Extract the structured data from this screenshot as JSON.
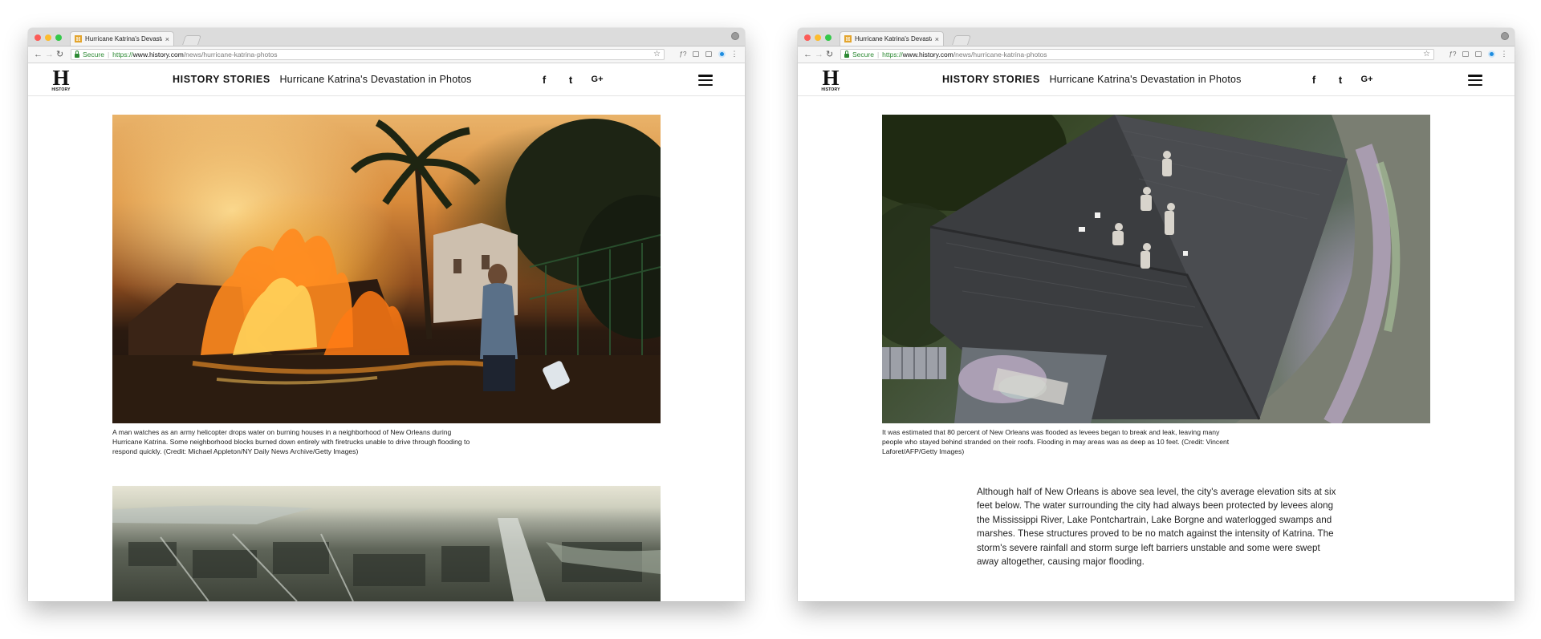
{
  "browser": {
    "tab_title": "Hurricane Katrina's Devastation",
    "favicon_letter": "H",
    "tab_close": "×",
    "secure_label": "Secure",
    "url_scheme": "https://",
    "url_host": "www.history.com",
    "url_path": "/news/hurricane-katrina-photos"
  },
  "site": {
    "logo_letter": "H",
    "logo_word": "HISTORY",
    "brand": "HISTORY STORIES",
    "article_title": "Hurricane Katrina's Devastation in Photos",
    "social": {
      "facebook": "f",
      "twitter": "t",
      "googleplus": "G+"
    }
  },
  "left_page": {
    "caption": "A man watches as an army helicopter drops water on burning houses in a neighborhood of New Orleans during Hurricane Katrina. Some neighborhood blocks burned down entirely with firetrucks unable to drive through flooding to respond quickly. (Credit: Michael Appleton/NY Daily News Archive/Getty Images)"
  },
  "right_page": {
    "caption": "It was estimated that 80 percent of New Orleans was flooded as levees began to break and leak, leaving many people who stayed behind stranded on their roofs. Flooding in may areas was as deep as 10 feet. (Credit: Vincent Laforet/AFP/Getty Images)",
    "body": "Although half of New Orleans is above sea level, the city's average elevation sits at six feet below. The water surrounding the city had always been protected by levees along the Mississippi River, Lake Pontchartrain, Lake Borgne and waterlogged swamps and marshes. These structures proved to be no match against the intensity of Katrina. The storm's severe rainfall and storm surge left barriers unstable and some were swept away altogether, causing major flooding."
  }
}
